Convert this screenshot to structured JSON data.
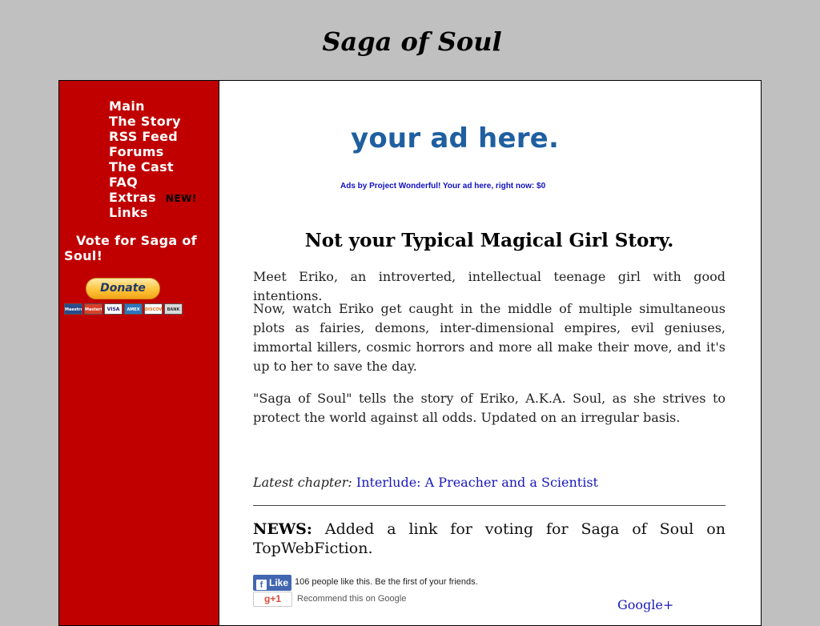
{
  "site": {
    "title": "Saga of Soul"
  },
  "sidebar": {
    "nav": [
      {
        "label": "Main"
      },
      {
        "label": "The Story"
      },
      {
        "label": "RSS Feed"
      },
      {
        "label": "Forums"
      },
      {
        "label": "The Cast"
      },
      {
        "label": "FAQ"
      },
      {
        "label": "Extras",
        "badge": "NEW!"
      },
      {
        "label": "Links"
      }
    ],
    "vote_link": "Vote for Saga of Soul!",
    "donate_label": "Donate",
    "payment_cards": [
      "Maestro",
      "MasterCard",
      "VISA",
      "AMEX",
      "DISCOVER",
      "BANK"
    ]
  },
  "main": {
    "ad_banner": "your ad here.",
    "ad_caption": "Ads by Project Wonderful! Your ad here, right now: $0",
    "headline": "Not your Typical Magical Girl Story.",
    "paragraphs": [
      "Meet Eriko, an introverted, intellectual teenage girl with good intentions.",
      "Now, watch Eriko get caught in the middle of multiple simultaneous plots as fairies, demons, inter-dimensional empires, evil geniuses, immortal killers, cosmic horrors and more all make their move, and it's up to her to save the day.",
      "\"Saga of Soul\" tells the story of Eriko, A.K.A. Soul, as she strives to protect the world against all odds. Updated on an irregular basis."
    ],
    "latest_label": "Latest chapter:",
    "latest_link": "Interlude: A Preacher and a Scientist",
    "news_label": "NEWS:",
    "news_text": " Added a link for voting for Saga of Soul on TopWebFiction.",
    "fb_like_label": "Like",
    "fb_like_text": "106 people like this. Be the first of your friends.",
    "gplus_label": "g+1",
    "gplus_text": "Recommend this on Google",
    "google_plus_link": "Google+"
  },
  "colors": {
    "sidebar": "#c00000",
    "background": "#c0c0c0",
    "link": "#1818b8",
    "ad": "#1f5fa0"
  }
}
